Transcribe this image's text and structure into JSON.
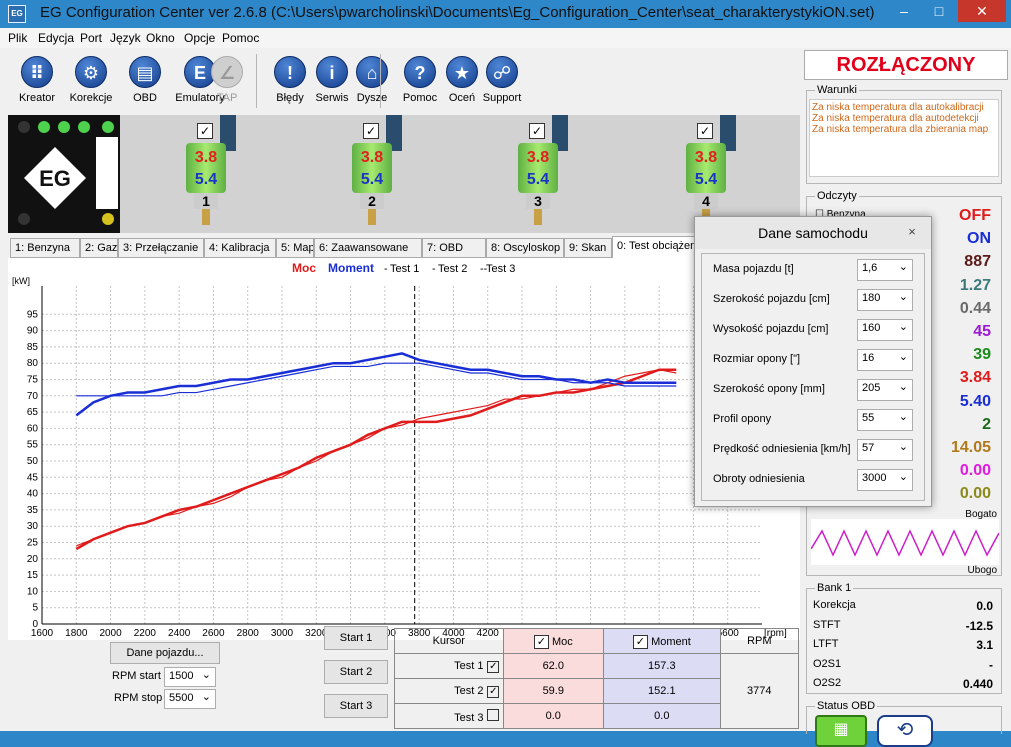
{
  "window": {
    "title": "EG Configuration Center ver 2.6.8 (C:\\Users\\pwarcholinski\\Documents\\Eg_Configuration_Center\\seat_charakterystykiON.set)",
    "icon": "eg-logo-icon",
    "minimize": "–",
    "maximize": "□",
    "close": "✕"
  },
  "menu": [
    "Plik",
    "Edycja",
    "Port",
    "Język",
    "Okno",
    "Opcje",
    "Pomoc"
  ],
  "toolbar": [
    {
      "label": "Kreator",
      "icon": "grid-icon",
      "glyph": "⠿",
      "enabled": true
    },
    {
      "label": "Korekcje",
      "icon": "gear-icon",
      "glyph": "⚙",
      "enabled": true
    },
    {
      "label": "OBD",
      "icon": "obd-connector-icon",
      "glyph": "▤",
      "enabled": true
    },
    {
      "label": "Emulatory",
      "icon": "emulator-icon",
      "glyph": "E",
      "enabled": true
    },
    {
      "label": "TAP",
      "icon": "tap-icon",
      "glyph": "∠",
      "enabled": false
    },
    {
      "label": "Błędy",
      "icon": "exclamation-icon",
      "glyph": "!",
      "enabled": true
    },
    {
      "label": "Serwis",
      "icon": "info-icon",
      "glyph": "i",
      "enabled": true
    },
    {
      "label": "Dysze",
      "icon": "injector-icon",
      "glyph": "⌂",
      "enabled": true
    },
    {
      "label": "Pomoc",
      "icon": "question-icon",
      "glyph": "?",
      "enabled": true
    },
    {
      "label": "Oceń",
      "icon": "star-icon",
      "glyph": "★",
      "enabled": true
    },
    {
      "label": "Support",
      "icon": "support-icon",
      "glyph": "☍",
      "enabled": true
    }
  ],
  "injectors": [
    {
      "check": "✓",
      "v1": "3.8",
      "v2": "5.4",
      "num": "1"
    },
    {
      "check": "✓",
      "v1": "3.8",
      "v2": "5.4",
      "num": "2"
    },
    {
      "check": "✓",
      "v1": "3.8",
      "v2": "5.4",
      "num": "3"
    },
    {
      "check": "✓",
      "v1": "3.8",
      "v2": "5.4",
      "num": "4"
    }
  ],
  "tabs": [
    {
      "label": "1: Benzyna"
    },
    {
      "label": "2: Gaz"
    },
    {
      "label": "3: Przełączanie"
    },
    {
      "label": "4: Kalibracja"
    },
    {
      "label": "5: Mapa"
    },
    {
      "label": "6: Zaawansowane"
    },
    {
      "label": "7: OBD"
    },
    {
      "label": "8: Oscyloskop"
    },
    {
      "label": "9: Skan"
    },
    {
      "label": "0: Test obciążen",
      "active": true
    }
  ],
  "legend": {
    "moc": "Moc",
    "moment": "Moment",
    "t1": "Test 1",
    "t2": "Test 2",
    "t3": "Test 3"
  },
  "colors": {
    "moc": "#e01b1b",
    "moment": "#1a2ed6",
    "accent": "#e0001b"
  },
  "chart_data": {
    "type": "line",
    "x": [
      1800,
      1900,
      2000,
      2100,
      2200,
      2300,
      2400,
      2500,
      2600,
      2700,
      2800,
      2900,
      3000,
      3100,
      3200,
      3300,
      3400,
      3500,
      3600,
      3700,
      3800,
      3900,
      4000,
      4100,
      4200,
      4300,
      4400,
      4500,
      4600,
      4700,
      4800,
      4900,
      5000,
      5100,
      5200,
      5300
    ],
    "xlim": [
      1600,
      5800
    ],
    "ylim": [
      0,
      100
    ],
    "y2lim": [
      0,
      100
    ],
    "xticks": [
      1600,
      1800,
      2000,
      2200,
      2400,
      2600,
      2800,
      3000,
      3200,
      3400,
      3600,
      3800,
      4000,
      4200,
      4400,
      4600,
      4800,
      5000,
      5200,
      5400,
      5600
    ],
    "yticks": [
      0,
      5,
      10,
      15,
      20,
      25,
      30,
      35,
      40,
      45,
      50,
      55,
      60,
      65,
      70,
      75,
      80,
      85,
      90,
      95
    ],
    "y2ticks": [
      60,
      65,
      70
    ],
    "xunit": "[rpm]",
    "yunit": "[kW]",
    "cursor_rpm": 3774,
    "series": [
      {
        "name": "Moc Test 1",
        "values": [
          23,
          26,
          28,
          30,
          31,
          33,
          35,
          36,
          38,
          40,
          42,
          44,
          46,
          48,
          51,
          53,
          55,
          58,
          60,
          62,
          62,
          62,
          63,
          64,
          66,
          68,
          70,
          70,
          71,
          71,
          72,
          73,
          74,
          76,
          78,
          78
        ]
      },
      {
        "name": "Moc Test 2",
        "values": [
          24,
          26,
          28,
          30,
          31,
          33,
          34,
          36,
          37,
          39,
          42,
          44,
          45,
          48,
          50,
          53,
          55,
          57,
          60,
          61,
          63,
          64,
          65,
          66,
          67,
          69,
          69,
          70,
          71,
          72,
          72,
          74,
          76,
          77,
          78,
          77
        ]
      },
      {
        "name": "Moment Test 1",
        "values": [
          64,
          68,
          70,
          71,
          71,
          72,
          73,
          73,
          74,
          75,
          75,
          76,
          77,
          78,
          79,
          80,
          80,
          81,
          82,
          83,
          81,
          80,
          79,
          78,
          78,
          77,
          76,
          76,
          75,
          75,
          74,
          75,
          74,
          74,
          74,
          74
        ]
      },
      {
        "name": "Moment Test 2",
        "values": [
          70,
          70,
          70,
          70,
          70,
          70,
          71,
          71,
          72,
          73,
          74,
          75,
          76,
          77,
          78,
          79,
          79,
          79,
          80,
          80,
          80,
          79,
          78,
          77,
          77,
          76,
          75,
          75,
          75,
          74,
          74,
          74,
          73,
          73,
          73,
          73
        ]
      }
    ]
  },
  "controls": {
    "dane_btn": "Dane pojazdu...",
    "rpm_start_label": "RPM start",
    "rpm_start": "1500",
    "rpm_stop_label": "RPM stop",
    "rpm_stop": "5500",
    "start1": "Start 1",
    "start2": "Start 2",
    "start3": "Start 3"
  },
  "results": {
    "h_kursor": "Kursor",
    "h_moc": "Moc",
    "h_moment": "Moment",
    "h_rpm": "RPM",
    "rpm": "3774",
    "rows": [
      {
        "label": "Test 1",
        "checked": "✓",
        "moc": "62.0",
        "moment": "157.3"
      },
      {
        "label": "Test 2",
        "checked": "✓",
        "moc": "59.9",
        "moment": "152.1"
      },
      {
        "label": "Test 3",
        "checked": "",
        "moc": "0.0",
        "moment": "0.0"
      }
    ]
  },
  "status": {
    "text": "ROZŁĄCZONY"
  },
  "warunki": {
    "title": "Warunki",
    "items": [
      "Za niska temperatura dla autokalibracji",
      "Za niska temperatura dla autodetekcji",
      "Za niska temperatura dla zbierania map"
    ]
  },
  "odczyty": {
    "title": "Odczyty",
    "first_label": "Benzyna",
    "values": [
      {
        "v": "OFF",
        "c": "#e01b1b"
      },
      {
        "v": "ON",
        "c": "#1a2ed6"
      },
      {
        "v": "887",
        "c": "#5a1a1a"
      },
      {
        "v": "1.27",
        "c": "#3a7a7a"
      },
      {
        "v": "0.44",
        "c": "#6a6a6a"
      },
      {
        "v": "45",
        "c": "#9a1ad6"
      },
      {
        "v": "39",
        "c": "#1a8a1a"
      },
      {
        "v": "3.84",
        "c": "#e01b1b"
      },
      {
        "v": "5.40",
        "c": "#1a2ed6"
      },
      {
        "v": "2",
        "c": "#1a6a1a"
      },
      {
        "v": "14.05",
        "c": "#b07a1a"
      },
      {
        "v": "0.00",
        "c": "#e01be0"
      },
      {
        "v": "0.00",
        "c": "#8a8a1a"
      }
    ],
    "bogato": "Bogato",
    "ubogo": "Ubogo"
  },
  "bank": {
    "title": "Bank 1",
    "rows": [
      {
        "k": "Korekcja",
        "v": "0.0"
      },
      {
        "k": "STFT",
        "v": "-12.5"
      },
      {
        "k": "LTFT",
        "v": "3.1"
      },
      {
        "k": "O2S1",
        "v": "-"
      },
      {
        "k": "O2S2",
        "v": "0.440"
      }
    ]
  },
  "obd": {
    "title": "Status OBD"
  },
  "dialog": {
    "title": "Dane samochodu",
    "close": "×",
    "rows": [
      {
        "label": "Masa pojazdu [t]",
        "value": "1,6"
      },
      {
        "label": "Szerokość pojazdu [cm]",
        "value": "180"
      },
      {
        "label": "Wysokość pojazdu [cm]",
        "value": "160"
      },
      {
        "label": "Rozmiar opony [\"]",
        "value": "16"
      },
      {
        "label": "Szerokość opony [mm]",
        "value": "205"
      },
      {
        "label": "Profil opony",
        "value": "55"
      },
      {
        "label": "Prędkość odniesienia [km/h]",
        "value": "57"
      },
      {
        "label": "Obroty odniesienia",
        "value": "3000"
      }
    ]
  }
}
